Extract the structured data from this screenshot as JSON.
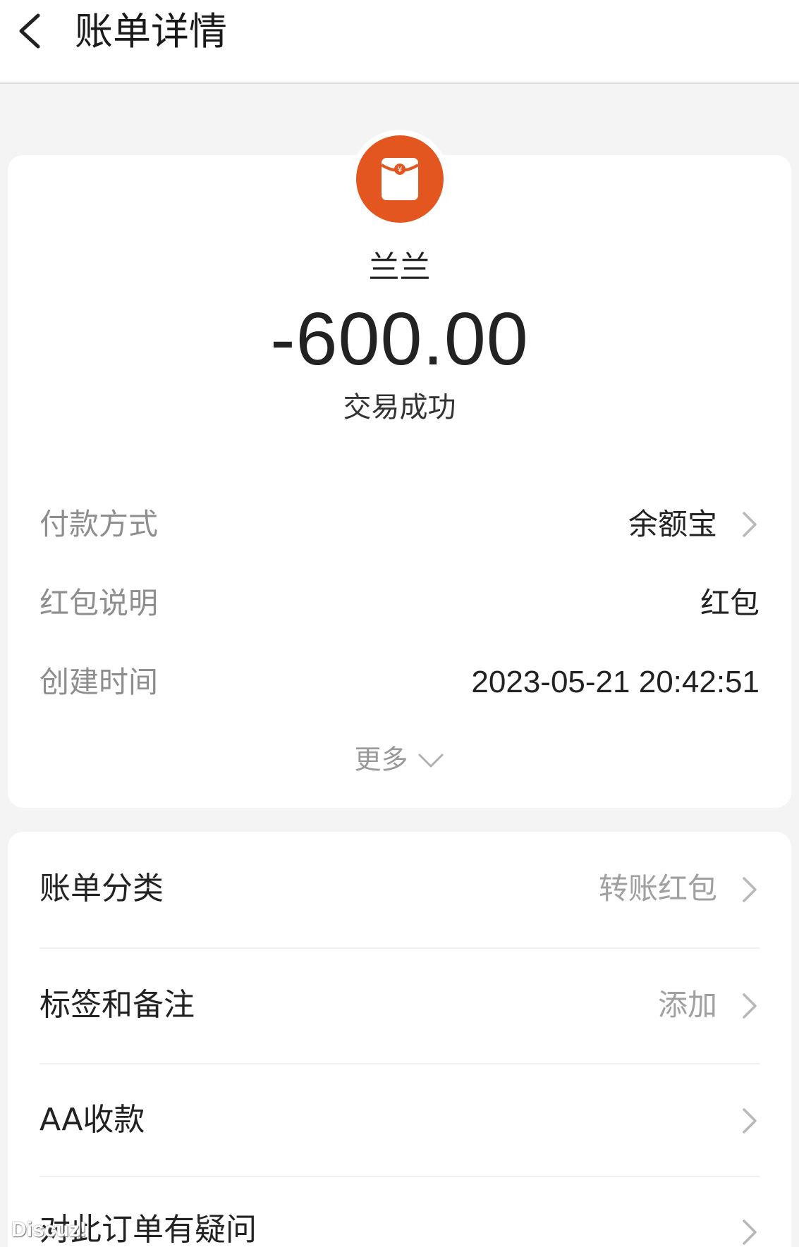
{
  "header": {
    "title": "账单详情",
    "back_icon": "chevron-left-icon"
  },
  "transaction": {
    "icon": "red-envelope-icon",
    "icon_color": "#e4561f",
    "payee": "兰兰",
    "amount": "-600.00",
    "status": "交易成功"
  },
  "details": [
    {
      "label": "付款方式",
      "value": "余额宝",
      "has_chevron": true
    },
    {
      "label": "红包说明",
      "value": "红包",
      "has_chevron": false
    },
    {
      "label": "创建时间",
      "value": "2023-05-21 20:42:51",
      "has_chevron": false
    }
  ],
  "more": {
    "label": "更多",
    "icon": "chevron-down-icon"
  },
  "actions": [
    {
      "label": "账单分类",
      "value": "转账红包"
    },
    {
      "label": "标签和备注",
      "value": "添加"
    },
    {
      "label": "AA收款",
      "value": ""
    },
    {
      "label": "对此订单有疑问",
      "value": ""
    }
  ],
  "watermark": "Discuz!"
}
